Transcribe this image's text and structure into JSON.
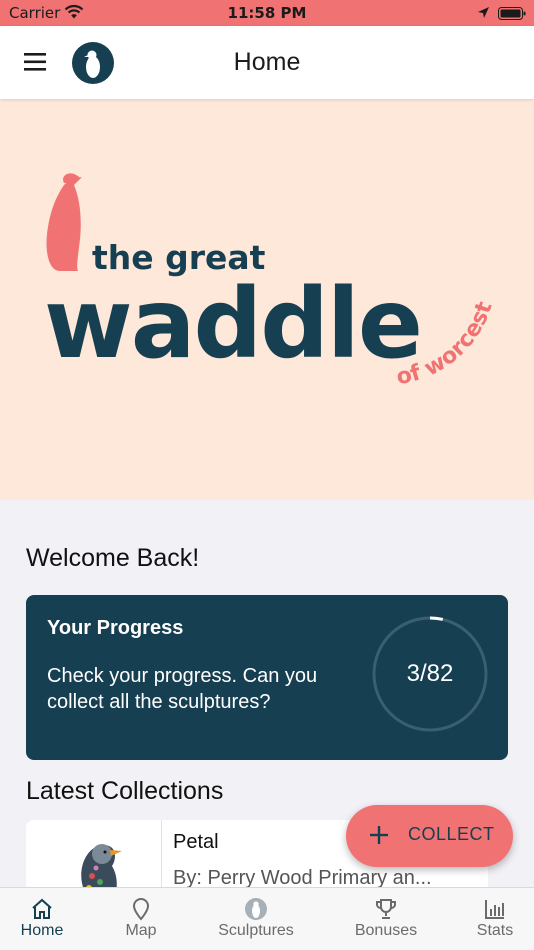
{
  "status_bar": {
    "carrier": "Carrier",
    "time": "11:58 PM"
  },
  "header": {
    "title": "Home"
  },
  "hero": {
    "logo_line1": "the great",
    "logo_line2": "waddle",
    "logo_line3": "of worcester"
  },
  "welcome": "Welcome Back!",
  "progress": {
    "title": "Your Progress",
    "description": "Check your progress. Can you collect all the sculptures?",
    "collected": 3,
    "total": 82,
    "label": "3/82"
  },
  "latest_collections": {
    "heading": "Latest Collections",
    "items": [
      {
        "name": "Petal",
        "by": "By: Perry Wood Primary an..."
      }
    ]
  },
  "fab": {
    "label": "COLLECT"
  },
  "tabs": [
    {
      "label": "Home",
      "icon": "home-icon",
      "active": true
    },
    {
      "label": "Map",
      "icon": "map-pin-icon",
      "active": false
    },
    {
      "label": "Sculptures",
      "icon": "penguin-icon",
      "active": false
    },
    {
      "label": "Bonuses",
      "icon": "trophy-icon",
      "active": false
    },
    {
      "label": "Stats",
      "icon": "bar-chart-icon",
      "active": false
    }
  ],
  "colors": {
    "accent": "#f07272",
    "navy": "#163f52",
    "hero_bg": "#fde8da",
    "page_bg": "#f2f1f6"
  }
}
